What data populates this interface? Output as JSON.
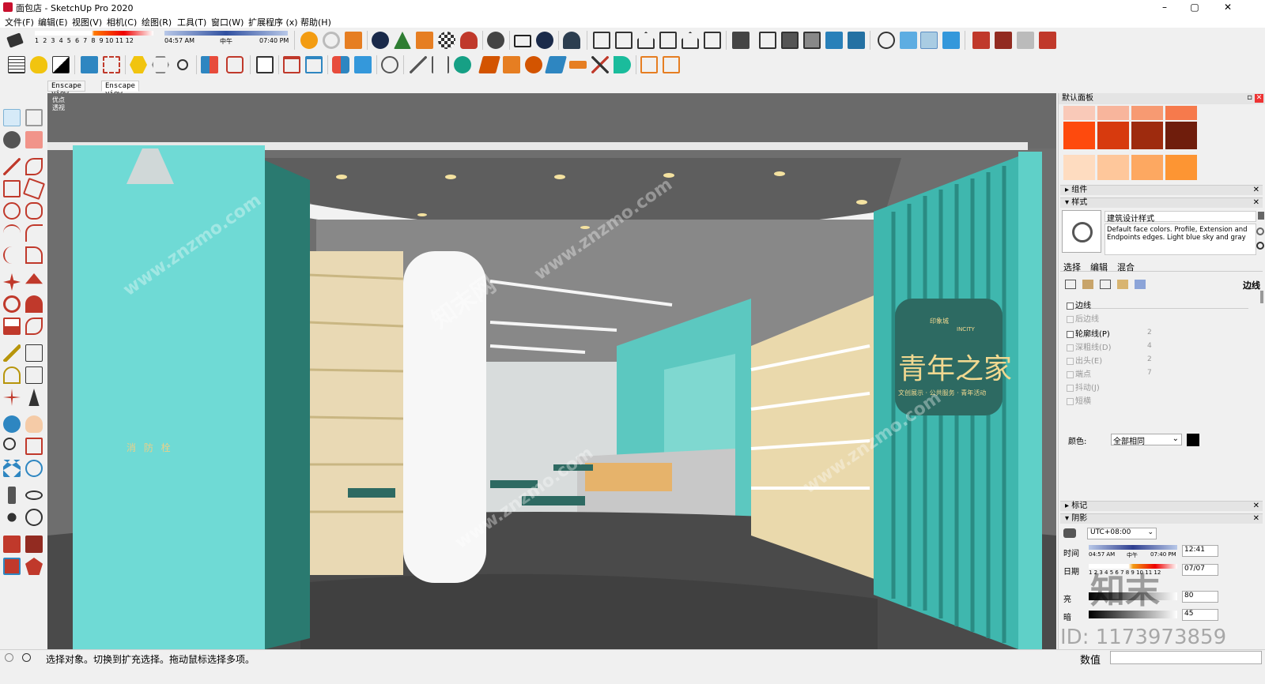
{
  "window": {
    "title": "面包店 - SketchUp Pro 2020",
    "minimize": "–",
    "maximize": "▢",
    "close": "✕"
  },
  "menu": [
    "文件(F)",
    "编辑(E)",
    "视图(V)",
    "相机(C)",
    "绘图(R)",
    "工具(T)",
    "窗口(W)",
    "扩展程序 (x)",
    "帮助(H)"
  ],
  "toolbar": {
    "shadow_months": [
      "1",
      "2",
      "3",
      "4",
      "5",
      "6",
      "7",
      "8",
      "9",
      "10",
      "11",
      "12"
    ],
    "shadow_time_start": "04:57 AM",
    "shadow_noon": "中午",
    "shadow_time_end": "07:40 PM"
  },
  "tabs": [
    "Enscape view",
    "Enscape view"
  ],
  "viewport": {
    "note_line1": "优点",
    "note_line2": "透视",
    "sign_fire": "消 防 栓",
    "brand_cn": "青年之家",
    "brand_en": "INCITY",
    "brand_logo": "印象城",
    "brand_tagline": "文创展示 · 公共服务 · 青年活动"
  },
  "panel": {
    "title": "默认面板",
    "swatch_colors": [
      "#f9c9b8",
      "#f8b59c",
      "#f79a72",
      "#f67a4c",
      "#fe4a0d",
      "#d73a0e",
      "#9e2b0e",
      "#6f1d0c",
      "#fedcc0",
      "#fec79b",
      "#fda861",
      "#fd9533"
    ],
    "sections": {
      "components": "组件",
      "styles": "样式",
      "tags": "标记",
      "shadows": "阴影"
    },
    "style_name": "建筑设计样式",
    "style_desc": "Default face colors. Profile, Extension and Endpoints edges. Light blue sky and gray",
    "style_tabs": [
      "选择",
      "编辑",
      "混合"
    ],
    "edge_label": "边线",
    "edge_settings": [
      {
        "label": "边线",
        "enabled": true,
        "value": ""
      },
      {
        "label": "后边线",
        "enabled": false,
        "value": ""
      },
      {
        "label": "轮廓线(P)",
        "enabled": true,
        "value": "2"
      },
      {
        "label": "深粗线(D)",
        "enabled": false,
        "value": "4"
      },
      {
        "label": "出头(E)",
        "enabled": false,
        "value": "2"
      },
      {
        "label": "端点",
        "enabled": false,
        "value": "7"
      },
      {
        "label": "抖动(J)",
        "enabled": false,
        "value": ""
      },
      {
        "label": "短横",
        "enabled": false,
        "value": ""
      }
    ],
    "color_label": "颜色:",
    "color_value": "全部相同",
    "shadow": {
      "tz": "UTC+08:00",
      "time_label": "时间",
      "date_label": "日期",
      "time_start": "04:57 AM",
      "noon": "中午",
      "time_end": "07:40 PM",
      "time_value": "12:41",
      "date_value": "07/07",
      "light_label": "亮",
      "dark_label": "暗",
      "light_value": "80",
      "dark_value": "45",
      "months": "1 2 3 4 5 6 7 8 9 10 11 12"
    }
  },
  "status": {
    "message": "选择对象。切换到扩充选择。拖动鼠标选择多项。",
    "value_label": "数值"
  },
  "watermark": {
    "site": "www.znzmo.com",
    "cn": "知末网",
    "logo": "知末",
    "id": "ID: 1173973859"
  }
}
